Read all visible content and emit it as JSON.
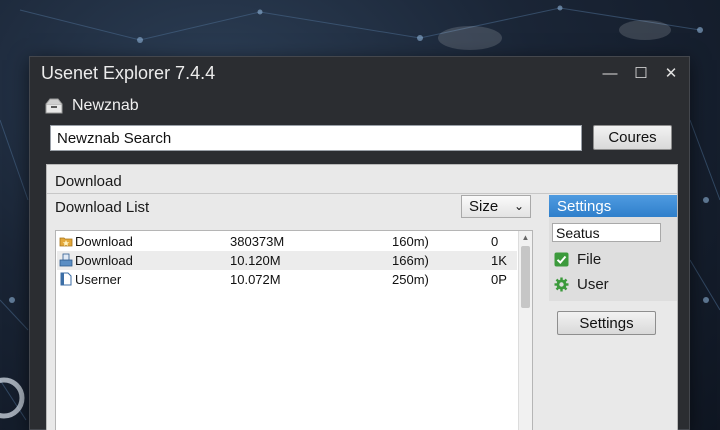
{
  "window": {
    "title": "Usenet Explorer 7.4.4",
    "controls": {
      "minimize": "—",
      "maximize": "☐",
      "close": "✕"
    }
  },
  "app_header": {
    "icon": "inbox-tray-icon",
    "label": "Newznab"
  },
  "search": {
    "value": "Newznab Search",
    "button_label": "Coures"
  },
  "panel": {
    "tab_label": "Download",
    "list_title": "Download List",
    "sort_select": {
      "value": "Size",
      "icon": "chevron-down-icon"
    }
  },
  "list": {
    "rows": [
      {
        "icon": "star-folder-icon",
        "name": "Download",
        "col_a": "380373M",
        "col_b": "160m)",
        "col_c": "0"
      },
      {
        "icon": "download-tray-icon",
        "name": "Download",
        "col_a": "10.120M",
        "col_b": "166m)",
        "col_c": "1K"
      },
      {
        "icon": "document-icon",
        "name": "Userner",
        "col_a": "10.072M",
        "col_b": "250m)",
        "col_c": "0P"
      }
    ]
  },
  "settings": {
    "header": "Settings",
    "status_value": "Seatus",
    "options": [
      {
        "icon": "green-check-icon",
        "label": "File"
      },
      {
        "icon": "green-gear-icon",
        "label": "User"
      }
    ],
    "button_label": "Settings"
  },
  "colors": {
    "window_bg": "#2b2d31",
    "panel_bg": "#e9e9e9",
    "accent_blue": "#3a88d4",
    "check_green": "#3c9a3c"
  }
}
